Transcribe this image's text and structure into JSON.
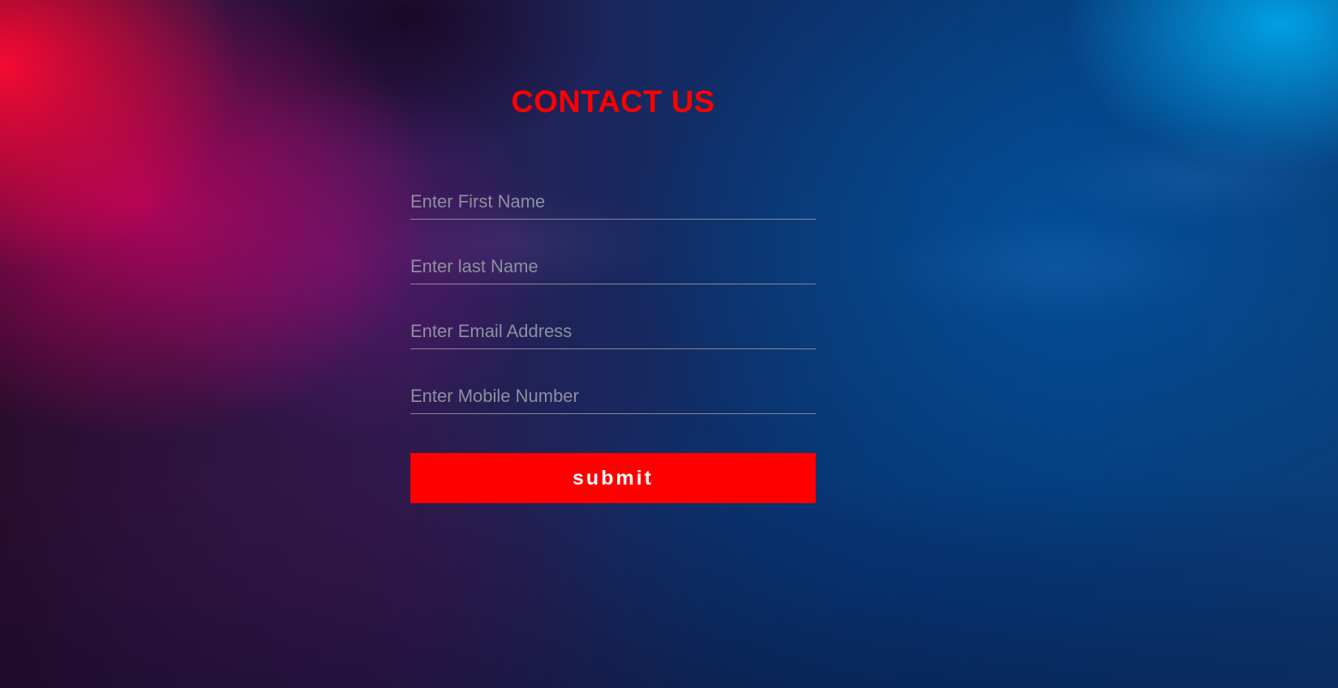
{
  "form": {
    "title": "CONTACT US",
    "fields": [
      {
        "placeholder": "Enter First Name",
        "value": ""
      },
      {
        "placeholder": "Enter last Name",
        "value": ""
      },
      {
        "placeholder": "Enter Email Address",
        "value": ""
      },
      {
        "placeholder": "Enter Mobile Number",
        "value": ""
      }
    ],
    "submit_label": "submit"
  },
  "colors": {
    "title": "#ff0000",
    "button": "#ff0000",
    "button_text": "#ffffff",
    "placeholder": "#8f8f9e",
    "underline": "#8a8a9a"
  }
}
